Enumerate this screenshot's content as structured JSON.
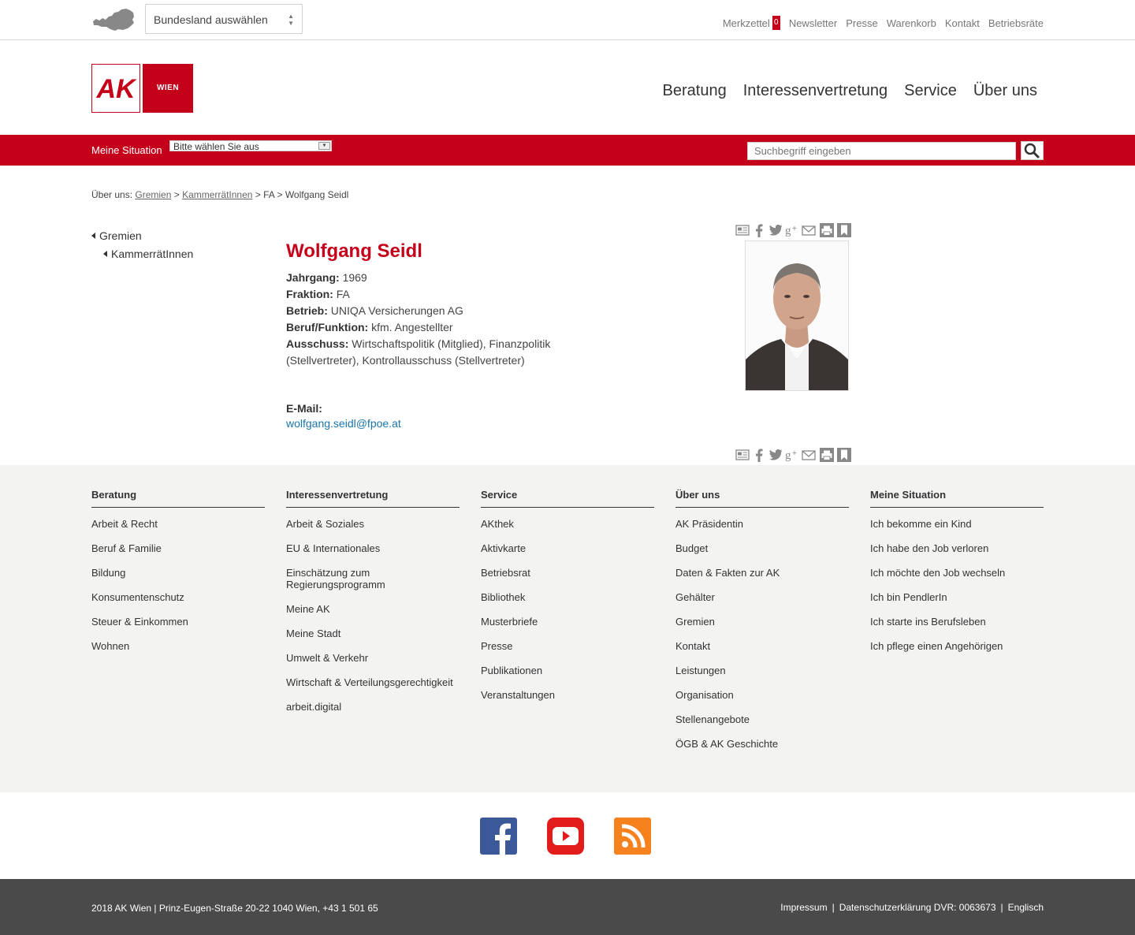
{
  "topbar": {
    "bundesland_select": "Bundesland auswählen",
    "merkzettel_label": "Merkzettel",
    "merkzettel_count": "0",
    "links": [
      "Newsletter",
      "Presse",
      "Warenkorb",
      "Kontakt",
      "Betriebsräte"
    ]
  },
  "logo": {
    "ak": "AK",
    "wien": "WIEN"
  },
  "mainnav": [
    "Beratung",
    "Interessenvertretung",
    "Service",
    "Über uns"
  ],
  "redbar": {
    "situation_label": "Meine Situation",
    "situation_value": "Bitte wählen Sie aus",
    "search_placeholder": "Suchbegriff eingeben"
  },
  "breadcrumb": {
    "prefix": "Über uns:",
    "crumb1": "Gremien",
    "sep1": " > ",
    "crumb2": "KammerrätInnen",
    "rest": " > FA > Wolfgang Seidl"
  },
  "leftnav": {
    "level1": "Gremien",
    "level2": "KammerrätInnen"
  },
  "person": {
    "name": "Wolfgang Seidl",
    "jahrgang_label": "Jahrgang:",
    "jahrgang": "1969",
    "fraktion_label": "Fraktion:",
    "fraktion": "FA",
    "betrieb_label": "Betrieb:",
    "betrieb": "UNIQA Versicherungen AG",
    "beruf_label": "Beruf/Funktion:",
    "beruf": "kfm. Angestellter",
    "ausschuss_label": "Ausschuss:",
    "ausschuss": "Wirtschaftspolitik (Mitglied), Finanzpolitik (Stellvertreter), Kontrollausschuss (Stellvertreter)",
    "email_label": "E-Mail:",
    "email": "wolfgang.seidl@fpoe.at"
  },
  "share_icons": [
    "newspaper-icon",
    "facebook-icon",
    "twitter-icon",
    "google-plus-icon",
    "mail-icon",
    "print-icon",
    "bookmark-icon"
  ],
  "footer": {
    "columns": [
      {
        "title": "Beratung",
        "items": [
          "Arbeit & Recht",
          "Beruf & Familie",
          "Bildung",
          "Konsumentenschutz",
          "Steuer & Einkommen",
          "Wohnen"
        ]
      },
      {
        "title": "Interessenvertretung",
        "items": [
          "Arbeit & Soziales",
          "EU & Internationales",
          "Einschätzung zum Regierungsprogramm",
          "Meine AK",
          "Meine Stadt",
          "Umwelt & Verkehr",
          "Wirtschaft & Verteilungsgerechtigkeit",
          "arbeit.digital"
        ]
      },
      {
        "title": "Service",
        "items": [
          "AKthek",
          "Aktivkarte",
          "Betriebsrat",
          "Bibliothek",
          "Musterbriefe",
          "Presse",
          "Publikationen",
          "Veranstaltungen"
        ]
      },
      {
        "title": "Über uns",
        "items": [
          "AK Präsidentin",
          "Budget",
          "Daten & Fakten zur AK",
          "Gehälter",
          "Gremien",
          "Kontakt",
          "Leistungen",
          "Organisation",
          "Stellenangebote",
          "ÖGB & AK Geschichte"
        ]
      },
      {
        "title": "Meine Situation",
        "items": [
          "Ich bekomme ein Kind",
          "Ich habe den Job verloren",
          "Ich möchte den Job wechseln",
          "Ich bin PendlerIn",
          "Ich starte ins Berufsleben",
          "Ich pflege einen Angehörigen"
        ]
      }
    ]
  },
  "social": [
    "facebook-icon",
    "youtube-icon",
    "rss-icon"
  ],
  "bottom": {
    "copyright": "2018 AK Wien | Prinz-Eugen-Straße 20-22 1040 Wien, +43 1 501 65",
    "impressum": "Impressum",
    "datenschutz": "Datenschutzerklärung DVR: 0063673",
    "englisch": "Englisch",
    "sep": "|"
  },
  "colors": {
    "brand_red": "#c4001a",
    "link_blue": "#1a75a8",
    "footer_bg": "#f3f3f2",
    "bottom_bg": "#4a4a4a"
  }
}
